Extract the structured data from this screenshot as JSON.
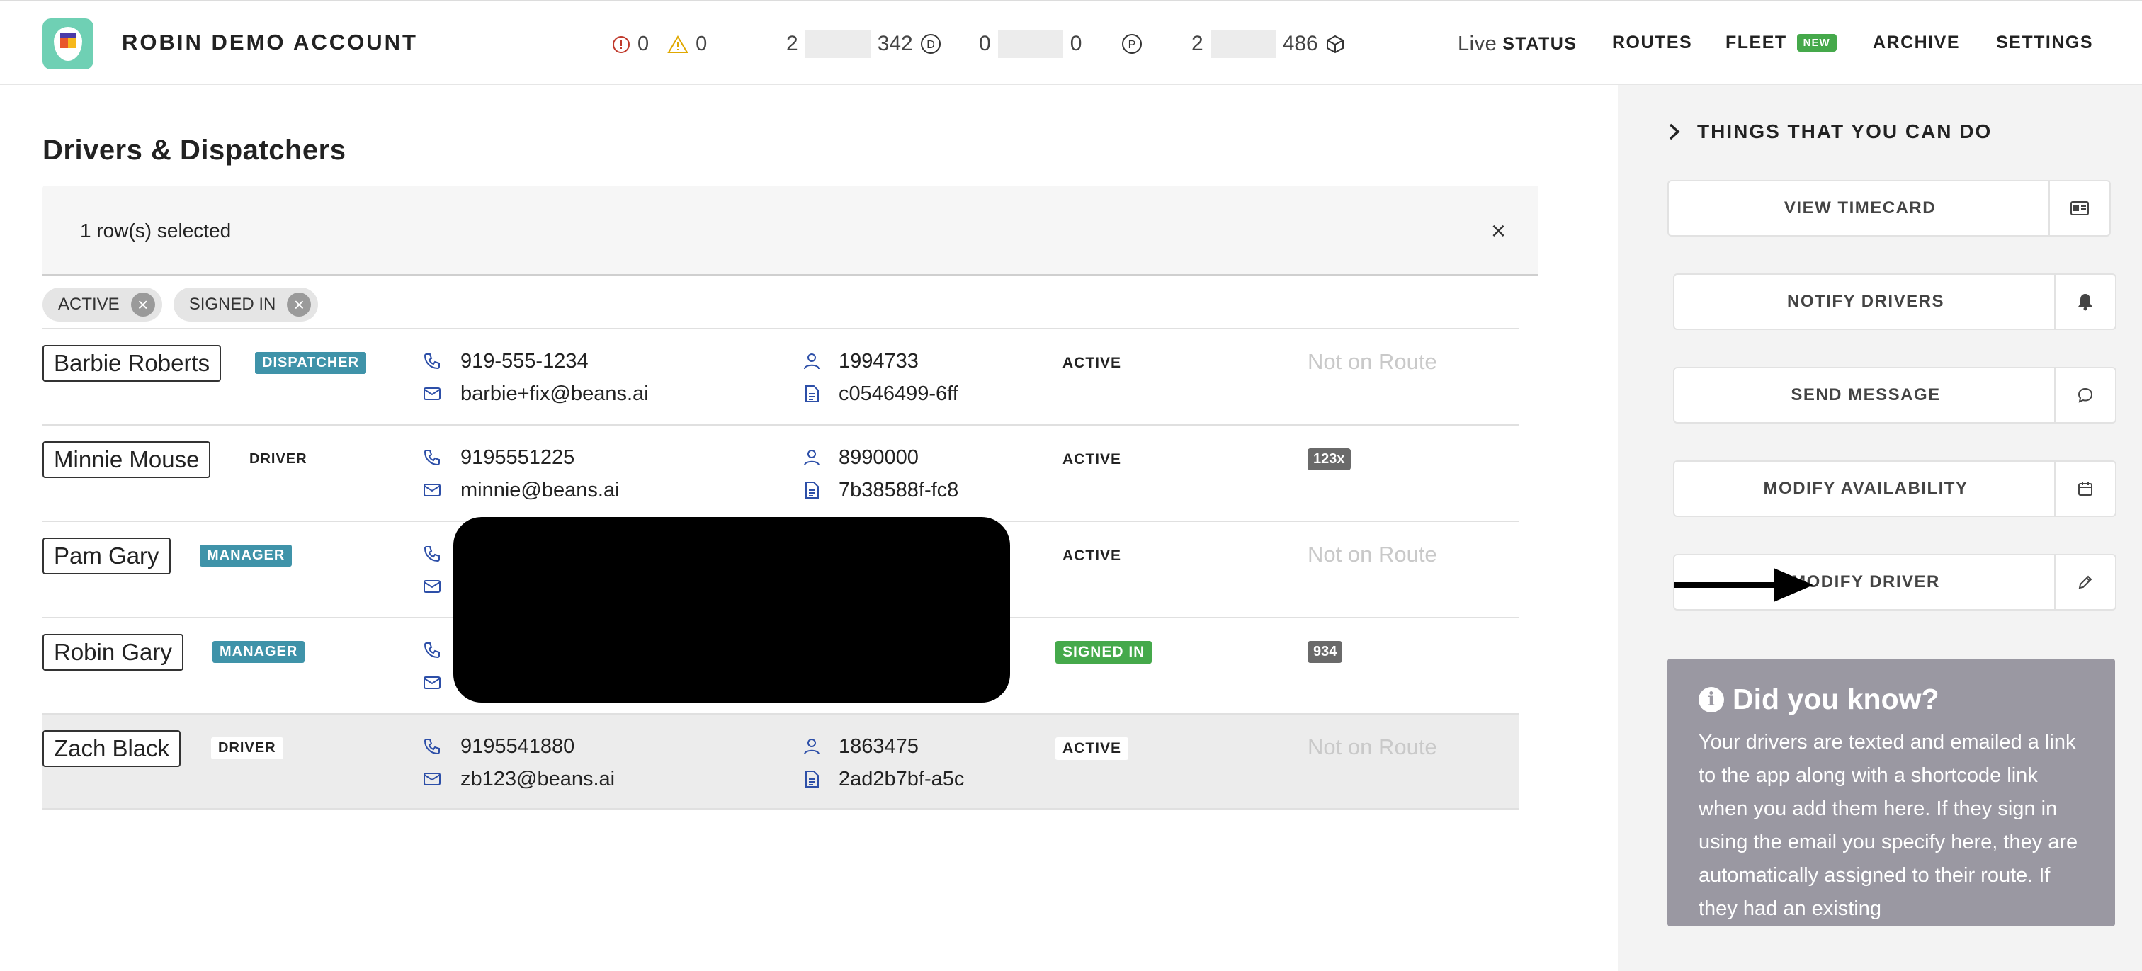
{
  "header": {
    "account_name": "ROBIN DEMO ACCOUNT",
    "alerts": {
      "errors": "0",
      "warnings": "0"
    },
    "stats": [
      {
        "left": "2",
        "right": "342",
        "icon": "D"
      },
      {
        "left": "0",
        "right": "0",
        "icon": "P"
      },
      {
        "left": "2",
        "right": "486",
        "icon": "package"
      }
    ],
    "nav": {
      "live": "Live",
      "status": "STATUS",
      "routes": "ROUTES",
      "fleet": "FLEET",
      "fleet_badge": "NEW",
      "archive": "ARCHIVE",
      "settings": "SETTINGS"
    }
  },
  "main": {
    "title": "Drivers & Dispatchers",
    "selection_text": "1 row(s) selected",
    "close_symbol": "×",
    "filters": [
      "ACTIVE",
      "SIGNED IN"
    ],
    "rows": [
      {
        "name": "Barbie Roberts",
        "role": "DISPATCHER",
        "role_style": "teal",
        "phone": "919-555-1234",
        "email": "barbie+fix@beans.ai",
        "user_id": "1994733",
        "doc_id": "c0546499-6ff",
        "status": "ACTIVE",
        "route": "Not on Route"
      },
      {
        "name": "Minnie Mouse",
        "role": "DRIVER",
        "role_style": "plain",
        "phone": "9195551225",
        "email": "minnie@beans.ai",
        "user_id": "8990000",
        "doc_id": "7b38588f-fc8",
        "status": "ACTIVE",
        "route_badge": "123x"
      },
      {
        "name": "Pam Gary",
        "role": "MANAGER",
        "role_style": "teal",
        "status": "ACTIVE",
        "route": "Not on Route"
      },
      {
        "name": "Robin Gary",
        "role": "MANAGER",
        "role_style": "teal",
        "status": "SIGNED IN",
        "route_badge": "934"
      },
      {
        "name": "Zach Black",
        "role": "DRIVER",
        "role_style": "plain",
        "phone": "9195541880",
        "email": "zb123@beans.ai",
        "user_id": "1863475",
        "doc_id": "2ad2b7bf-a5c",
        "status": "ACTIVE",
        "route": "Not on Route"
      }
    ]
  },
  "side": {
    "title": "THINGS THAT YOU CAN DO",
    "actions": {
      "view_timecard": "VIEW TIMECARD",
      "notify_drivers": "NOTIFY DRIVERS",
      "send_message": "SEND MESSAGE",
      "modify_availability": "MODIFY AVAILABILITY",
      "modify_driver": "MODIFY DRIVER"
    },
    "did_you_know": {
      "title": "Did you know?",
      "text": "Your drivers are texted and emailed a link to the app along with a shortcode link when you add them here. If they sign in using the email you specify here, they are automatically assigned to their route. If they had an existing"
    }
  },
  "colors": {
    "teal": "#3f93a9",
    "green": "#45a94b",
    "logo_bg": "#6fd0b4",
    "panel_bg": "#9a98a2"
  }
}
